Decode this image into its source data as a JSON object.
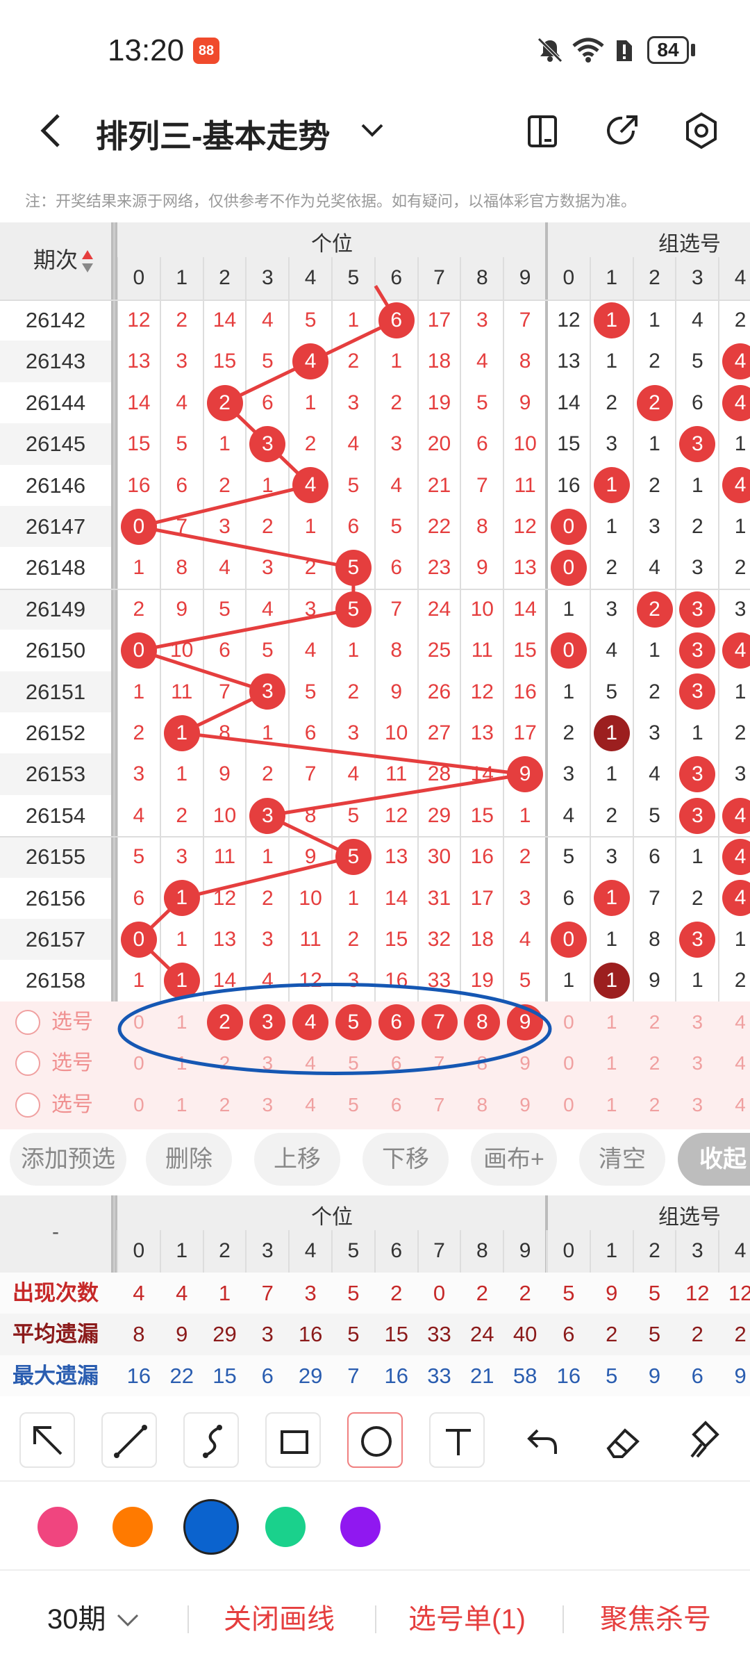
{
  "status": {
    "time": "13:20",
    "app_badge": "88",
    "battery": "84"
  },
  "toolbar": {
    "title": "排列三-基本走势",
    "back_icon": "back-arrow-icon",
    "dropdown_icon": "chevron-down-icon",
    "icons": [
      "phone-layout-icon",
      "share-icon",
      "settings-icon"
    ]
  },
  "note": "注：开奖结果来源于网络，仅供参考不作为兑奖依据。如有疑问，以福体彩官方数据为准。",
  "grid": {
    "period_header": "期次",
    "unit_header": "个位",
    "group_header": "组选号",
    "digits": [
      "0",
      "1",
      "2",
      "3",
      "4",
      "5",
      "6",
      "7",
      "8",
      "9"
    ],
    "group_digits": [
      "0",
      "1",
      "2",
      "3",
      "4"
    ],
    "rows": [
      {
        "period": "26142",
        "unit": [
          12,
          2,
          14,
          4,
          5,
          1,
          "6",
          17,
          3,
          7
        ],
        "group": [
          12,
          "1",
          1,
          4,
          2
        ]
      },
      {
        "period": "26143",
        "unit": [
          13,
          3,
          15,
          5,
          "4",
          2,
          1,
          18,
          4,
          8
        ],
        "group": [
          13,
          1,
          2,
          5,
          "4"
        ]
      },
      {
        "period": "26144",
        "unit": [
          14,
          4,
          "2",
          6,
          1,
          3,
          2,
          19,
          5,
          9
        ],
        "group": [
          14,
          2,
          "2",
          6,
          "4"
        ]
      },
      {
        "period": "26145",
        "unit": [
          15,
          5,
          1,
          "3",
          2,
          4,
          3,
          20,
          6,
          10
        ],
        "group": [
          15,
          3,
          1,
          "3",
          1
        ]
      },
      {
        "period": "26146",
        "unit": [
          16,
          6,
          2,
          1,
          "4",
          5,
          4,
          21,
          7,
          11
        ],
        "group": [
          16,
          "1",
          2,
          1,
          "4"
        ]
      },
      {
        "period": "26147",
        "unit": [
          "0",
          7,
          3,
          2,
          1,
          6,
          5,
          22,
          8,
          12
        ],
        "group": [
          "0",
          1,
          3,
          2,
          1
        ]
      },
      {
        "period": "26148",
        "unit": [
          1,
          8,
          4,
          3,
          2,
          "5",
          6,
          23,
          9,
          13
        ],
        "group": [
          "0",
          2,
          4,
          3,
          2
        ]
      },
      {
        "period": "26149",
        "unit": [
          2,
          9,
          5,
          4,
          3,
          "5",
          7,
          24,
          10,
          14
        ],
        "group": [
          1,
          3,
          "2",
          "3",
          3
        ]
      },
      {
        "period": "26150",
        "unit": [
          "0",
          10,
          6,
          5,
          4,
          1,
          8,
          25,
          11,
          15
        ],
        "group": [
          "0",
          4,
          1,
          "3",
          "4"
        ]
      },
      {
        "period": "26151",
        "unit": [
          1,
          11,
          7,
          "3",
          5,
          2,
          9,
          26,
          12,
          16
        ],
        "group": [
          1,
          5,
          2,
          "3",
          1
        ]
      },
      {
        "period": "26152",
        "unit": [
          2,
          "1",
          8,
          1,
          6,
          3,
          10,
          27,
          13,
          17
        ],
        "group": [
          2,
          "D1",
          3,
          1,
          2
        ]
      },
      {
        "period": "26153",
        "unit": [
          3,
          1,
          9,
          2,
          7,
          4,
          11,
          28,
          14,
          "9"
        ],
        "group": [
          3,
          1,
          4,
          "3",
          3
        ]
      },
      {
        "period": "26154",
        "unit": [
          4,
          2,
          10,
          "3",
          8,
          5,
          12,
          29,
          15,
          1
        ],
        "group": [
          4,
          2,
          5,
          "3",
          "4"
        ]
      },
      {
        "period": "26155",
        "unit": [
          5,
          3,
          11,
          1,
          9,
          "5",
          13,
          30,
          16,
          2
        ],
        "group": [
          5,
          3,
          6,
          1,
          "4"
        ]
      },
      {
        "period": "26156",
        "unit": [
          6,
          "1",
          12,
          2,
          10,
          1,
          14,
          31,
          17,
          3
        ],
        "group": [
          6,
          "1",
          7,
          2,
          "4"
        ]
      },
      {
        "period": "26157",
        "unit": [
          "0",
          1,
          13,
          3,
          11,
          2,
          15,
          32,
          18,
          4
        ],
        "group": [
          "0",
          1,
          8,
          "3",
          1
        ]
      },
      {
        "period": "26158",
        "unit": [
          1,
          "1",
          14,
          4,
          12,
          3,
          16,
          33,
          19,
          5
        ],
        "group": [
          1,
          "D1",
          9,
          1,
          2
        ]
      }
    ],
    "pick_label": "选号",
    "pick_rows": [
      {
        "selected": [
          2,
          3,
          4,
          5,
          6,
          7,
          8,
          9
        ]
      },
      {
        "selected": []
      },
      {
        "selected": []
      }
    ]
  },
  "buttons": [
    "添加预选",
    "删除",
    "上移",
    "下移",
    "画布+",
    "清空",
    "收起"
  ],
  "stats": {
    "corner": "-",
    "unit_header": "个位",
    "group_header": "组选号",
    "digits": [
      "0",
      "1",
      "2",
      "3",
      "4",
      "5",
      "6",
      "7",
      "8",
      "9"
    ],
    "group_digits": [
      "0",
      "1",
      "2",
      "3",
      "4"
    ],
    "rows": [
      {
        "label": "出现次数",
        "color": "#c62828",
        "unit": [
          "4",
          "4",
          "1",
          "7",
          "3",
          "5",
          "2",
          "0",
          "2",
          "2"
        ],
        "group": [
          "5",
          "9",
          "5",
          "12",
          "12"
        ]
      },
      {
        "label": "平均遗漏",
        "color": "#8b1a1a",
        "unit": [
          "8",
          "9",
          "29",
          "3",
          "16",
          "5",
          "15",
          "33",
          "24",
          "40"
        ],
        "group": [
          "6",
          "2",
          "5",
          "2",
          "2"
        ]
      },
      {
        "label": "最大遗漏",
        "color": "#2a5db0",
        "unit": [
          "16",
          "22",
          "15",
          "6",
          "29",
          "7",
          "16",
          "33",
          "21",
          "58"
        ],
        "group": [
          "16",
          "5",
          "9",
          "6",
          "9"
        ]
      }
    ]
  },
  "draw_tools": [
    "arrow-tool-icon",
    "line-tool-icon",
    "curve-tool-icon",
    "rect-tool-icon",
    "circle-tool-icon",
    "text-tool-icon",
    "undo-icon",
    "eraser-icon",
    "clear-brush-icon"
  ],
  "colors": {
    "accent": "#e53e3e",
    "palette": [
      "#f0457f",
      "#ff7a00",
      "#0b63ce",
      "#1ad18c",
      "#9018f0"
    ],
    "selected_color": "#0b63ce"
  },
  "bottom": {
    "period": "30期",
    "close_lines": "关闭画线",
    "pick_list": "选号单(1)",
    "focus_kill": "聚焦杀号"
  }
}
